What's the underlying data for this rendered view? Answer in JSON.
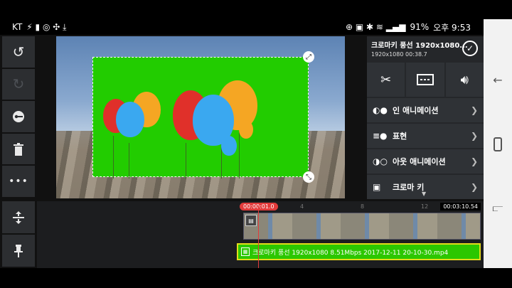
{
  "status": {
    "carrier": "KT",
    "battery": "91%",
    "time": "오후 9:53"
  },
  "left_toolbar": {
    "undo_icon": "undo-icon",
    "redo_icon": "redo-icon",
    "key_icon": "key-icon",
    "delete_icon": "trash-icon",
    "more_label": "•••",
    "split_icon": "split-icon",
    "pin_icon": "pin-icon"
  },
  "clip": {
    "title": "크로마키 풍선 1920x1080...",
    "meta": "1920x1080  00:38.7"
  },
  "panel": {
    "items": [
      {
        "label": "인 애니메이션"
      },
      {
        "label": "표현"
      },
      {
        "label": "아웃 애니메이션"
      },
      {
        "label": "크로마 키"
      }
    ]
  },
  "timeline": {
    "current_time": "00:00:01.0",
    "end_time": "00:03:10.54",
    "ruler_marks": [
      "4",
      "8",
      "12"
    ],
    "layer_file": "크로마키 풍선 1920x1080 8.51Mbps 2017-12-11 20-10-30.mp4"
  },
  "colors": {
    "chroma_green": "#22cc00",
    "playhead_red": "#e23b3b",
    "layer_yellow": "#e3dc1a"
  }
}
